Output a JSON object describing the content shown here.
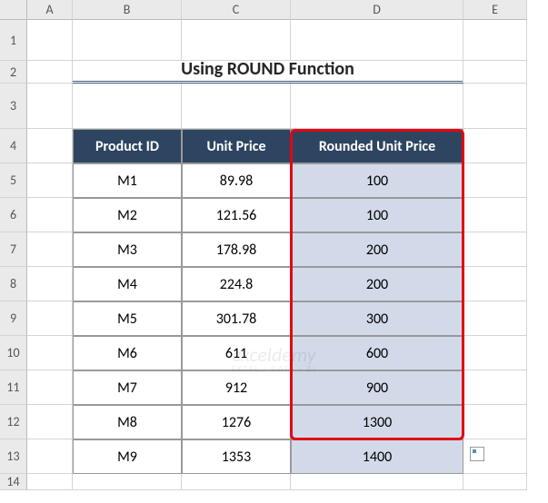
{
  "columns": [
    "A",
    "B",
    "C",
    "D",
    "E"
  ],
  "rows": [
    "1",
    "2",
    "3",
    "4",
    "5",
    "6",
    "7",
    "8",
    "9",
    "10",
    "11",
    "12",
    "13",
    "14"
  ],
  "title": "Using ROUND Function",
  "headers": {
    "product_id": "Product ID",
    "unit_price": "Unit Price",
    "rounded": "Rounded Unit Price"
  },
  "data": [
    {
      "id": "M1",
      "price": "89.98",
      "rounded": "100"
    },
    {
      "id": "M2",
      "price": "121.56",
      "rounded": "100"
    },
    {
      "id": "M3",
      "price": "178.98",
      "rounded": "200"
    },
    {
      "id": "M4",
      "price": "224.8",
      "rounded": "200"
    },
    {
      "id": "M5",
      "price": "301.78",
      "rounded": "300"
    },
    {
      "id": "M6",
      "price": "611",
      "rounded": "600"
    },
    {
      "id": "M7",
      "price": "912",
      "rounded": "900"
    },
    {
      "id": "M8",
      "price": "1276",
      "rounded": "1300"
    },
    {
      "id": "M9",
      "price": "1353",
      "rounded": "1400"
    }
  ],
  "watermark": {
    "main": "exceldemy",
    "sub": "EXCEL · DATA · BI"
  }
}
